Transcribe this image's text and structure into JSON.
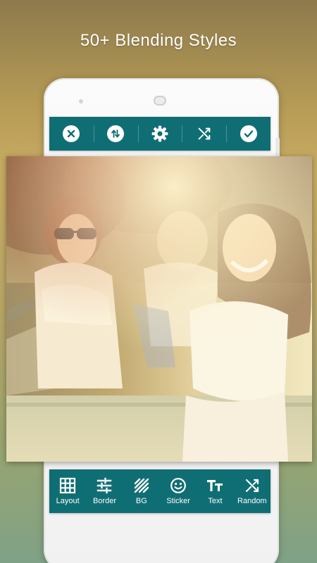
{
  "headline": "50+ Blending Styles",
  "colors": {
    "toolbar": "#0f6e73",
    "icon": "#ffffff",
    "background_top": "#8d7a4c",
    "background_bottom": "#7fa287"
  },
  "top_toolbar": {
    "items": [
      {
        "icon": "close-circle-icon"
      },
      {
        "icon": "swap-vertical-icon"
      },
      {
        "icon": "gear-icon"
      },
      {
        "icon": "shuffle-icon"
      },
      {
        "icon": "check-circle-icon"
      }
    ]
  },
  "bottom_toolbar": {
    "items": [
      {
        "label": "Layout",
        "icon": "grid-icon"
      },
      {
        "label": "Border",
        "icon": "sliders-icon"
      },
      {
        "label": "BG",
        "icon": "diagonal-stripes-icon"
      },
      {
        "label": "Sticker",
        "icon": "smiley-icon"
      },
      {
        "label": "Text",
        "icon": "text-size-icon"
      },
      {
        "label": "Random",
        "icon": "shuffle-icon"
      }
    ]
  }
}
